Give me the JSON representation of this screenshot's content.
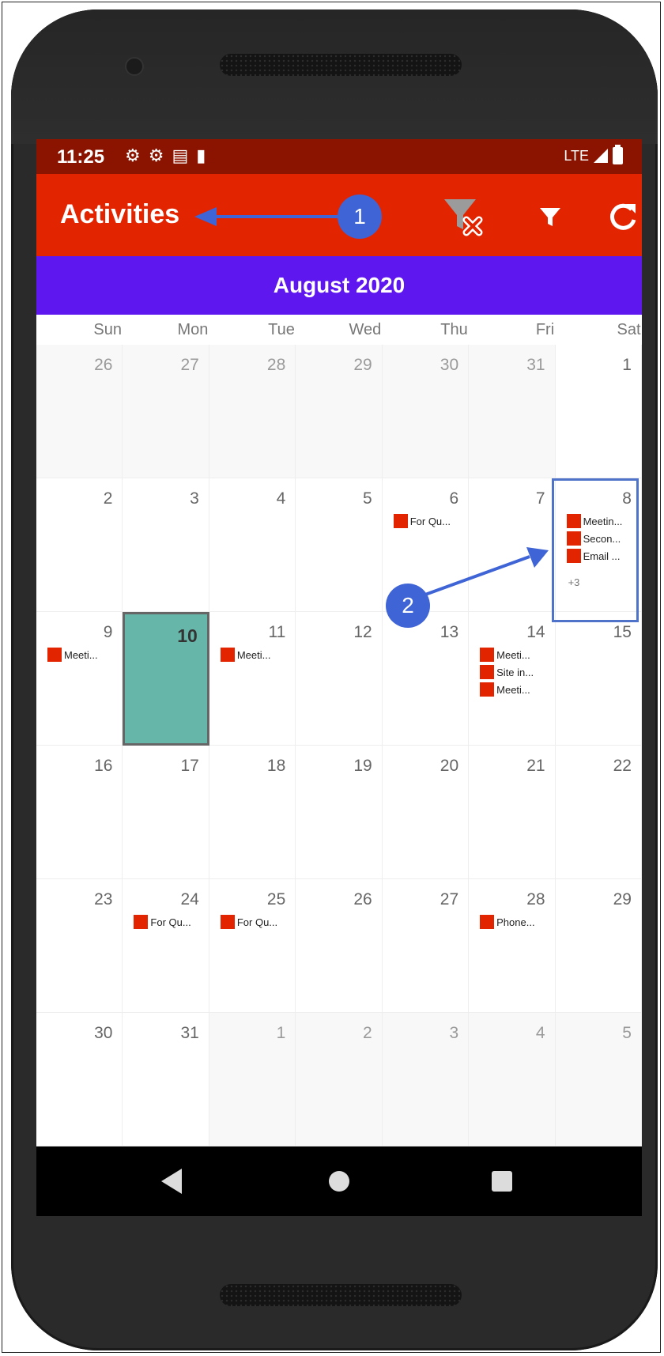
{
  "status_bar": {
    "time": "11:25",
    "icons": [
      "gear-icon",
      "gear-icon",
      "card-icon",
      "sd-card-icon"
    ],
    "network": "LTE"
  },
  "toolbar": {
    "title": "Activities",
    "actions": [
      "clear-filter-icon",
      "filter-icon",
      "refresh-icon"
    ]
  },
  "calendar": {
    "month_label": "August 2020",
    "weekdays": [
      "Sun",
      "Mon",
      "Tue",
      "Wed",
      "Thu",
      "Fri",
      "Sat"
    ],
    "selected_day": "10",
    "weeks": [
      [
        {
          "day": "26",
          "other": true,
          "events": []
        },
        {
          "day": "27",
          "other": true,
          "events": []
        },
        {
          "day": "28",
          "other": true,
          "events": []
        },
        {
          "day": "29",
          "other": true,
          "events": []
        },
        {
          "day": "30",
          "other": true,
          "events": []
        },
        {
          "day": "31",
          "other": true,
          "events": []
        },
        {
          "day": "1",
          "events": []
        }
      ],
      [
        {
          "day": "2",
          "events": []
        },
        {
          "day": "3",
          "events": []
        },
        {
          "day": "4",
          "events": []
        },
        {
          "day": "5",
          "events": []
        },
        {
          "day": "6",
          "events": [
            "For Qu..."
          ]
        },
        {
          "day": "7",
          "events": []
        },
        {
          "day": "8",
          "events": [
            "Meetin...",
            "Secon...",
            "Email  ..."
          ],
          "more": "+3"
        }
      ],
      [
        {
          "day": "9",
          "events": [
            "Meeti..."
          ]
        },
        {
          "day": "10",
          "today": true,
          "events": []
        },
        {
          "day": "11",
          "events": [
            "Meeti..."
          ]
        },
        {
          "day": "12",
          "events": []
        },
        {
          "day": "13",
          "events": []
        },
        {
          "day": "14",
          "events": [
            "Meeti...",
            "Site in...",
            "Meeti..."
          ]
        },
        {
          "day": "15",
          "events": []
        }
      ],
      [
        {
          "day": "16",
          "events": []
        },
        {
          "day": "17",
          "events": []
        },
        {
          "day": "18",
          "events": []
        },
        {
          "day": "19",
          "events": []
        },
        {
          "day": "20",
          "events": []
        },
        {
          "day": "21",
          "events": []
        },
        {
          "day": "22",
          "events": []
        }
      ],
      [
        {
          "day": "23",
          "events": []
        },
        {
          "day": "24",
          "events": [
            "For Qu..."
          ]
        },
        {
          "day": "25",
          "events": [
            "For Qu..."
          ]
        },
        {
          "day": "26",
          "events": []
        },
        {
          "day": "27",
          "events": []
        },
        {
          "day": "28",
          "events": [
            "Phone..."
          ]
        },
        {
          "day": "29",
          "events": []
        }
      ],
      [
        {
          "day": "30",
          "events": []
        },
        {
          "day": "31",
          "events": []
        },
        {
          "day": "1",
          "other": true,
          "events": []
        },
        {
          "day": "2",
          "other": true,
          "events": []
        },
        {
          "day": "3",
          "other": true,
          "events": []
        },
        {
          "day": "4",
          "other": true,
          "events": []
        },
        {
          "day": "5",
          "other": true,
          "events": []
        }
      ]
    ]
  },
  "nav_bar": {
    "buttons": [
      "back-icon",
      "home-icon",
      "recent-apps-icon"
    ]
  },
  "annotations": {
    "marker_1": "1",
    "marker_2": "2"
  },
  "colors": {
    "status_bar": "#8b1400",
    "toolbar": "#e22400",
    "month_header": "#5f17f0",
    "event_swatch": "#e22400",
    "today_cell": "#66b7aa",
    "annotation": "#3f64d6"
  }
}
